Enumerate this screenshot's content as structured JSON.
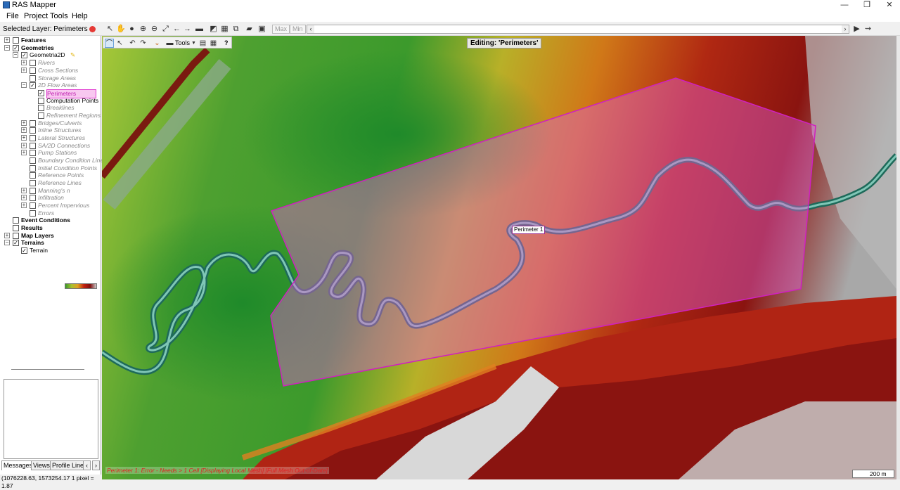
{
  "window": {
    "title": "RAS Mapper",
    "minimize": "—",
    "restore": "❐",
    "close": "✕"
  },
  "menu": [
    "File",
    "Project",
    "Tools",
    "Help"
  ],
  "toolbar": {
    "selected_layer": "Selected Layer: Perimeters",
    "max_label": "Max",
    "min_label": "Min"
  },
  "tree": {
    "features": "Features",
    "geometries": "Geometries",
    "geometry_name": "Geometria2D",
    "rivers": "Rivers",
    "cross_sections": "Cross Sections",
    "storage_areas": "Storage Areas",
    "flow_areas_2d": "2D Flow Areas",
    "perimeters": "Perimeters",
    "computation_points": "Computation Points",
    "breaklines": "Breaklines",
    "refinement_regions": "Refinement Regions",
    "bridges": "Bridges/Culverts",
    "inline_structures": "Inline Structures",
    "lateral_structures": "Lateral Structures",
    "sa2d_connections": "SA/2D Connections",
    "pump_stations": "Pump Stations",
    "boundary_condition_lines": "Boundary Condition Lines",
    "initial_condition_points": "Initial Condition Points",
    "reference_points": "Reference Points",
    "reference_lines": "Reference Lines",
    "mannings_n": "Manning's n",
    "infiltration": "Infiltration",
    "percent_impervious": "Percent Impervious",
    "errors": "Errors",
    "event_conditions": "Event Conditions",
    "results": "Results",
    "map_layers": "Map Layers",
    "terrains": "Terrains",
    "terrain": "Terrain"
  },
  "tabs": [
    "Messages",
    "Views",
    "Profile Lines"
  ],
  "map": {
    "edit_tools_label": "Tools",
    "help_label": "?",
    "editing_label": "Editing: 'Perimeters'",
    "perimeter_label": "Perimeter 1",
    "status_message": "Perimeter 1: Error - Needs > 1 Cell   [Displaying Local Mesh]   [Full Mesh Out-of-Date]",
    "scale": "200 m"
  },
  "statusbar": {
    "coords": "(1076228.63, 1573254.17  1 pixel = 1.87"
  },
  "colors": {
    "perimeter_fill": "#e060d0",
    "perimeter_stroke": "#d020c0",
    "terrain_low": "#3a9a2a",
    "terrain_high": "#9a1a10"
  }
}
